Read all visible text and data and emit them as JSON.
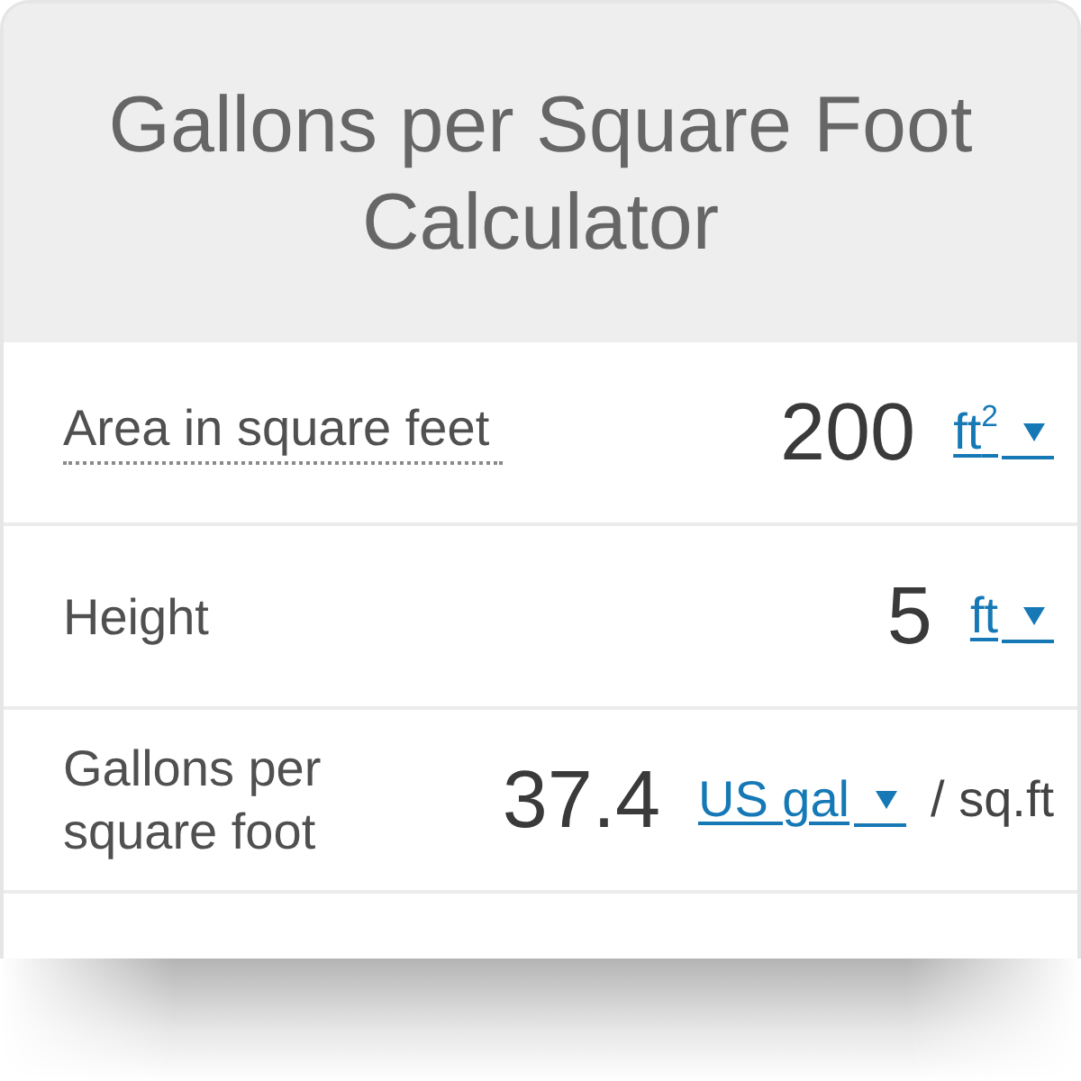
{
  "title": "Gallons per Square Foot Calculator",
  "fields": [
    {
      "label": "Area in square feet",
      "has_hint": true,
      "value": "200",
      "unit": "ft$^{2}$"
    },
    {
      "label": "Height",
      "has_hint": false,
      "value": "5",
      "unit": "ft"
    },
    {
      "label": "Gallons per square foot",
      "has_hint": false,
      "value": "37.4",
      "unit": "US gal",
      "suffix": "/ sq.ft"
    }
  ]
}
